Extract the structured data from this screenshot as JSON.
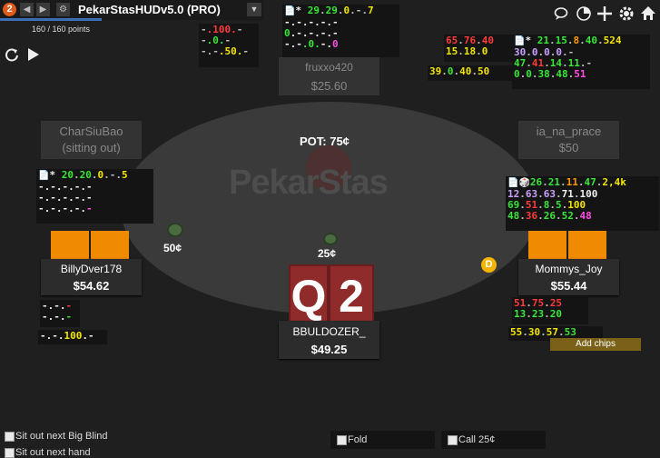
{
  "app": {
    "badge": "2",
    "title": "PekarStasHUDv5.0 (PRO)",
    "points": "160 / 160 points",
    "progress": 1.0
  },
  "toolbar": {
    "back_icon": "chevron-left",
    "forward_icon": "chevron-right",
    "gear_icon": "gear",
    "dropdown_icon": "triangle-down"
  },
  "top_right_icons": [
    "chat-icon",
    "timer-icon",
    "plus-icon",
    "gear-icon",
    "home-icon"
  ],
  "table": {
    "brand": "PekarStas",
    "pot_label": "POT: 75¢"
  },
  "seats": {
    "top": {
      "name": "fruxxo420",
      "stack": "$25.60"
    },
    "left": {
      "name": "CharSiuBao",
      "stack": "(sitting out)"
    },
    "right": {
      "name": "ia_na_prace",
      "stack": "$50"
    },
    "billy": {
      "name": "BillyDver178",
      "stack": "$54.62",
      "bet": "50¢"
    },
    "mommy": {
      "name": "Mommys_Joy",
      "stack": "$55.44",
      "dealer": "D"
    },
    "hero": {
      "name": "BBULDOZER_",
      "stack": "$49.25",
      "bet": "25¢",
      "cards": [
        "Q",
        "2"
      ]
    }
  },
  "add_chips": "Add chips",
  "options": {
    "sit_out_bb": "Sit out next Big Blind",
    "sit_out_hand": "Sit out next hand"
  },
  "actions": {
    "fold": "Fold",
    "call": "Call 25¢"
  },
  "colors": {
    "table": "#3a3a3a",
    "card": "#8f2b2b",
    "orange": "#f08a00",
    "dealer": "#f5b400"
  },
  "hud": {
    "fruxxo_small": [
      [
        [
          "-",
          "grey"
        ],
        [
          ".100.",
          "red"
        ],
        [
          "-",
          "grey"
        ]
      ],
      [
        [
          "-",
          "grey"
        ],
        [
          ".0.",
          "green"
        ],
        [
          "-",
          "grey"
        ]
      ],
      [
        [
          "-.-",
          "grey"
        ],
        [
          ".50.",
          "yellow"
        ],
        [
          "-",
          "grey"
        ]
      ]
    ],
    "fruxxo_main": [
      [
        [
          "* ",
          "white"
        ],
        [
          "29",
          "green"
        ],
        [
          ".",
          "grey"
        ],
        [
          "29",
          "green"
        ],
        [
          ".",
          "grey"
        ],
        [
          "0",
          "yellow"
        ],
        [
          ".-.",
          "grey"
        ],
        [
          "7",
          "yellow"
        ]
      ],
      [
        [
          "-.-.-.-.-",
          "white"
        ]
      ],
      [
        [
          "0",
          "green"
        ],
        [
          ".-.-.-.-",
          "white"
        ]
      ],
      [
        [
          "-.-",
          "white"
        ],
        [
          ".0.",
          "green"
        ],
        [
          "-.",
          "white"
        ],
        [
          "0",
          "pink"
        ]
      ]
    ],
    "ia_left": [
      [
        [
          "65",
          "red"
        ],
        [
          ".",
          "grey"
        ],
        [
          "76",
          "red"
        ],
        [
          ".",
          "grey"
        ],
        [
          "40",
          "red"
        ]
      ],
      [
        [
          "15",
          "yellow"
        ],
        [
          ".",
          "grey"
        ],
        [
          "18",
          "yellow"
        ],
        [
          ".",
          "grey"
        ],
        [
          "0",
          "yellow"
        ]
      ]
    ],
    "ia_mid": [
      [
        [
          "39",
          "yellow"
        ],
        [
          ".",
          "grey"
        ],
        [
          "0",
          "green"
        ],
        [
          ".",
          "grey"
        ],
        [
          "40",
          "yellow"
        ],
        [
          ".",
          "grey"
        ],
        [
          "50",
          "yellow"
        ]
      ]
    ],
    "ia_main": [
      [
        [
          "* ",
          "white"
        ],
        [
          "21",
          "green"
        ],
        [
          ".",
          "grey"
        ],
        [
          "15",
          "green"
        ],
        [
          ".",
          "grey"
        ],
        [
          "8",
          "orange"
        ],
        [
          ".",
          "grey"
        ],
        [
          "40",
          "green"
        ],
        [
          ".",
          "grey"
        ],
        [
          "524",
          "yellow"
        ]
      ],
      [
        [
          "30",
          "lilac"
        ],
        [
          ".",
          "grey"
        ],
        [
          "0",
          "lilac"
        ],
        [
          ".",
          "grey"
        ],
        [
          "0",
          "lilac"
        ],
        [
          ".",
          "grey"
        ],
        [
          "0",
          "lilac"
        ],
        [
          ".-",
          "grey"
        ]
      ],
      [
        [
          "47",
          "green"
        ],
        [
          ".",
          "grey"
        ],
        [
          "41",
          "red"
        ],
        [
          ".",
          "grey"
        ],
        [
          "14",
          "green"
        ],
        [
          ".",
          "grey"
        ],
        [
          "11",
          "green"
        ],
        [
          ".-",
          "grey"
        ]
      ],
      [
        [
          "0",
          "green"
        ],
        [
          ".",
          "grey"
        ],
        [
          "0",
          "green"
        ],
        [
          ".",
          "grey"
        ],
        [
          "38",
          "green"
        ],
        [
          ".",
          "grey"
        ],
        [
          "48",
          "green"
        ],
        [
          ".",
          "grey"
        ],
        [
          "51",
          "pink"
        ]
      ]
    ],
    "billy_main": [
      [
        [
          "* ",
          "white"
        ],
        [
          "20",
          "green"
        ],
        [
          ".",
          "grey"
        ],
        [
          "20",
          "green"
        ],
        [
          ".",
          "grey"
        ],
        [
          "0",
          "yellow"
        ],
        [
          ".-.",
          "grey"
        ],
        [
          "5",
          "yellow"
        ]
      ],
      [
        [
          "-.-.-.-.-",
          "white"
        ]
      ],
      [
        [
          "-.-.-.-.-",
          "white"
        ]
      ],
      [
        [
          "-.-.-.-.",
          "white"
        ],
        [
          "-",
          "pink"
        ]
      ]
    ],
    "billy_small": [
      [
        [
          "-.-.",
          "white"
        ],
        [
          "-",
          "red"
        ]
      ],
      [
        [
          "-.-.",
          "white"
        ],
        [
          "-",
          "green"
        ]
      ]
    ],
    "billy_bottom": [
      [
        [
          "-.-.",
          "white"
        ],
        [
          "100",
          "yellow"
        ],
        [
          ".-",
          "white"
        ]
      ]
    ],
    "mommy_main": [
      [
        [
          "26",
          "green"
        ],
        [
          ".",
          "grey"
        ],
        [
          "21",
          "green"
        ],
        [
          ".",
          "grey"
        ],
        [
          "11",
          "orange"
        ],
        [
          ".",
          "grey"
        ],
        [
          "47",
          "green"
        ],
        [
          ".",
          "grey"
        ],
        [
          "2,4k",
          "yellow"
        ]
      ],
      [
        [
          "12",
          "lilac"
        ],
        [
          ".",
          "grey"
        ],
        [
          "63",
          "lilac"
        ],
        [
          ".",
          "grey"
        ],
        [
          "63",
          "lilac"
        ],
        [
          ".",
          "grey"
        ],
        [
          "71",
          "white"
        ],
        [
          ".",
          "grey"
        ],
        [
          "100",
          "white"
        ]
      ],
      [
        [
          "69",
          "green"
        ],
        [
          ".",
          "grey"
        ],
        [
          "51",
          "red"
        ],
        [
          ".",
          "grey"
        ],
        [
          "8",
          "green"
        ],
        [
          ".",
          "grey"
        ],
        [
          "5",
          "green"
        ],
        [
          ".",
          "grey"
        ],
        [
          "100",
          "yellow"
        ]
      ],
      [
        [
          "48",
          "green"
        ],
        [
          ".",
          "grey"
        ],
        [
          "36",
          "red"
        ],
        [
          ".",
          "grey"
        ],
        [
          "26",
          "green"
        ],
        [
          ".",
          "grey"
        ],
        [
          "52",
          "green"
        ],
        [
          ".",
          "grey"
        ],
        [
          "48",
          "pink"
        ]
      ]
    ],
    "mommy_low": [
      [
        [
          "51",
          "red"
        ],
        [
          ".",
          "grey"
        ],
        [
          "75",
          "red"
        ],
        [
          ".",
          "grey"
        ],
        [
          "25",
          "red"
        ]
      ],
      [
        [
          "13",
          "green"
        ],
        [
          ".",
          "grey"
        ],
        [
          "23",
          "green"
        ],
        [
          ".",
          "grey"
        ],
        [
          "20",
          "green"
        ]
      ]
    ],
    "mommy_bottom": [
      [
        [
          "55",
          "yellow"
        ],
        [
          ".",
          "grey"
        ],
        [
          "30",
          "yellow"
        ],
        [
          ".",
          "grey"
        ],
        [
          "57",
          "yellow"
        ],
        [
          ".",
          "grey"
        ],
        [
          "53",
          "green"
        ]
      ]
    ]
  }
}
